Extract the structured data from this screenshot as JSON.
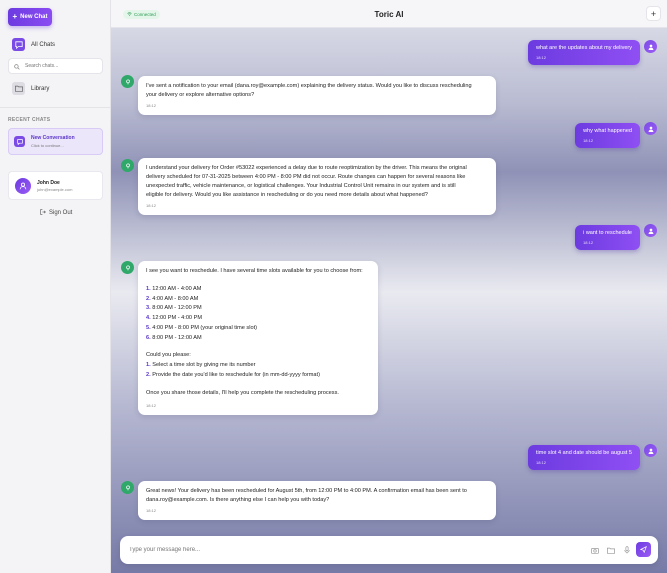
{
  "sidebar": {
    "new_chat_label": "New Chat",
    "all_chats_label": "All Chats",
    "search_placeholder": "Search chats...",
    "library_label": "Library",
    "recent_chats_label": "RECENT CHATS",
    "recent": [
      {
        "title": "New Conversation",
        "subtitle": "Click to continue..."
      }
    ],
    "user": {
      "name": "John Doe",
      "email": "john@example.com"
    },
    "sign_out_label": "Sign Out"
  },
  "header": {
    "status": "Connected",
    "title": "Toric AI"
  },
  "messages": [
    {
      "role": "user",
      "text": "what are the updates about my delivery",
      "time": "18:12"
    },
    {
      "role": "bot",
      "lines": [
        "I've sent a notification to your email (dana.roy@example.com) explaining the delivery status. Would you like to discuss rescheduling",
        "your delivery or explore alternative options?"
      ],
      "time": "18:12"
    },
    {
      "role": "user",
      "text": "why what happened",
      "time": "18:12"
    },
    {
      "role": "bot",
      "lines": [
        "I understand your delivery for Order #53022 experienced a delay due to route reoptimization by the driver. This means the original",
        "delivery scheduled for 07-31-2025 between 4:00 PM - 8:00 PM did not occur. Route changes can happen for several reasons like",
        "unexpected traffic, vehicle maintenance, or logistical challenges. Your Industrial Control Unit remains in our system and is still",
        "eligible for delivery. Would you like assistance in rescheduling or do you need more details about what happened?"
      ],
      "time": "18:12"
    },
    {
      "role": "user",
      "text": "i want to reschedule",
      "time": "18:12"
    },
    {
      "role": "bot",
      "intro": "I see you want to reschedule. I have several time slots available for you to choose from:",
      "slots": [
        {
          "n": "1.",
          "t": "12:00 AM - 4:00 AM"
        },
        {
          "n": "2.",
          "t": "4:00 AM - 8:00 AM"
        },
        {
          "n": "3.",
          "t": "8:00 AM - 12:00 PM"
        },
        {
          "n": "4.",
          "t": "12:00 PM - 4:00 PM"
        },
        {
          "n": "5.",
          "t": "4:00 PM - 8:00 PM (your original time slot)"
        },
        {
          "n": "6.",
          "t": "8:00 PM - 12:00 AM"
        }
      ],
      "please": "Could you please:",
      "steps": [
        {
          "n": "1.",
          "t": "Select a time slot by giving me its number"
        },
        {
          "n": "2.",
          "t": "Provide the date you'd like to reschedule for (in mm-dd-yyyy format)"
        }
      ],
      "outro": "Once you share those details, I'll help you complete the rescheduling process.",
      "time": "18:12"
    },
    {
      "role": "user",
      "text": "time slot 4 and date should be august 5",
      "time": "18:12"
    },
    {
      "role": "bot",
      "lines": [
        "Great news! Your delivery has been rescheduled for August 5th, from 12:00 PM to 4:00 PM. A confirmation email has been sent to",
        "dana.roy@example.com. Is there anything else I can help you with today?"
      ],
      "time": "18:12"
    }
  ],
  "composer": {
    "placeholder": "Type your message here..."
  },
  "colors": {
    "accent": "#6c3be0",
    "bot_avatar": "#2fa86a",
    "connected": "#2c9a52"
  }
}
